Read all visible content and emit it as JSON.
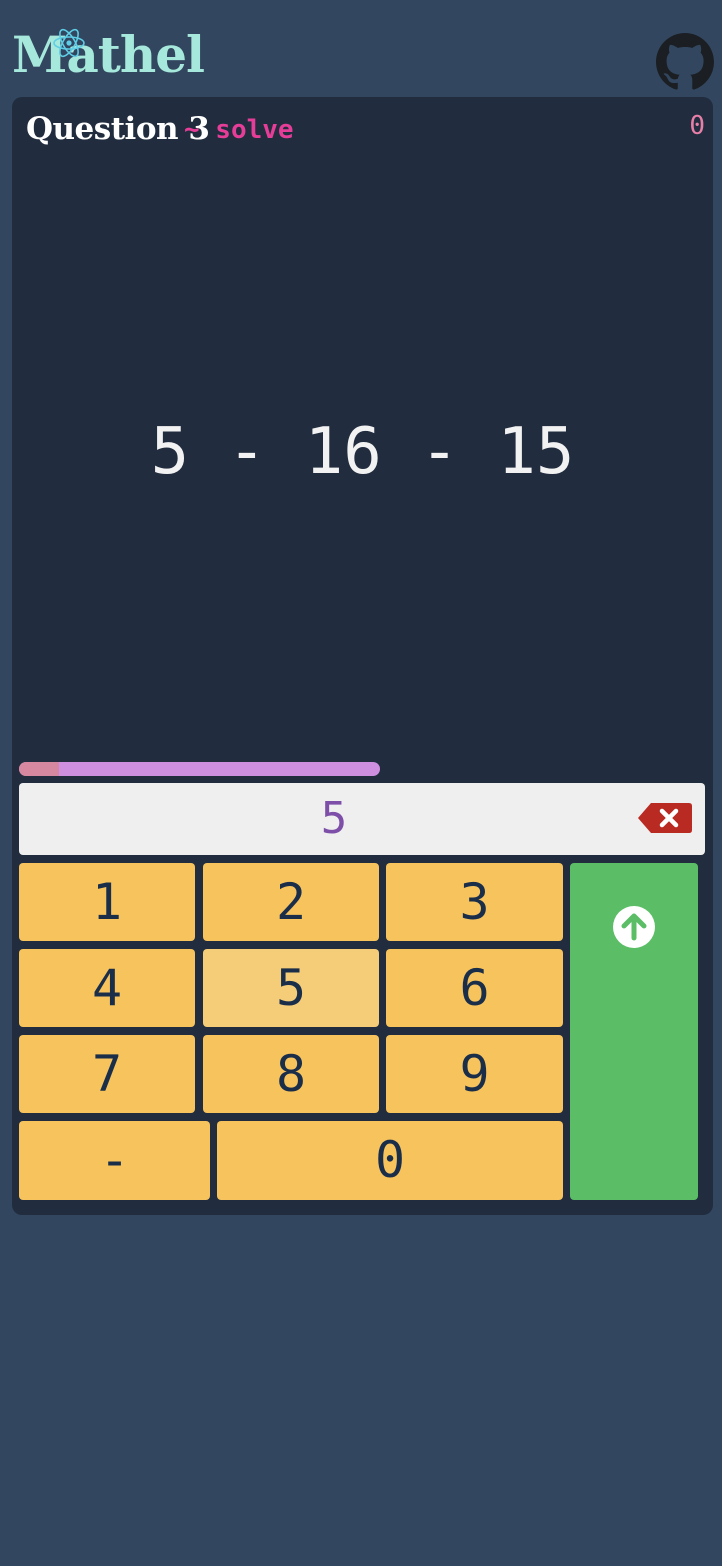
{
  "header": {
    "logo_text": "Mathel",
    "logo_icon": "atom-icon",
    "github_icon": "github-icon"
  },
  "question": {
    "title": "Question 3",
    "mode": "~ solve",
    "score": "0",
    "expression": "5 - 16 - 15"
  },
  "timer": {
    "remaining_fraction": 0.5
  },
  "answer": {
    "value": "5",
    "backspace_icon": "backspace-icon"
  },
  "keypad": {
    "keys": [
      "1",
      "2",
      "3",
      "4",
      "5",
      "6",
      "7",
      "8",
      "9",
      "-",
      "0"
    ],
    "submit_icon": "arrow-up-circle-icon"
  },
  "colors": {
    "background": "#32475f",
    "card": "#212d3e",
    "logo": "#a6e9dc",
    "mode": "#e63e98",
    "score": "#e87fa8",
    "key": "#f7c35c",
    "key_pressed": "#f5cd78",
    "submit": "#5bbe66",
    "backspace": "#b82a22",
    "timer": "#cf8fe0"
  }
}
